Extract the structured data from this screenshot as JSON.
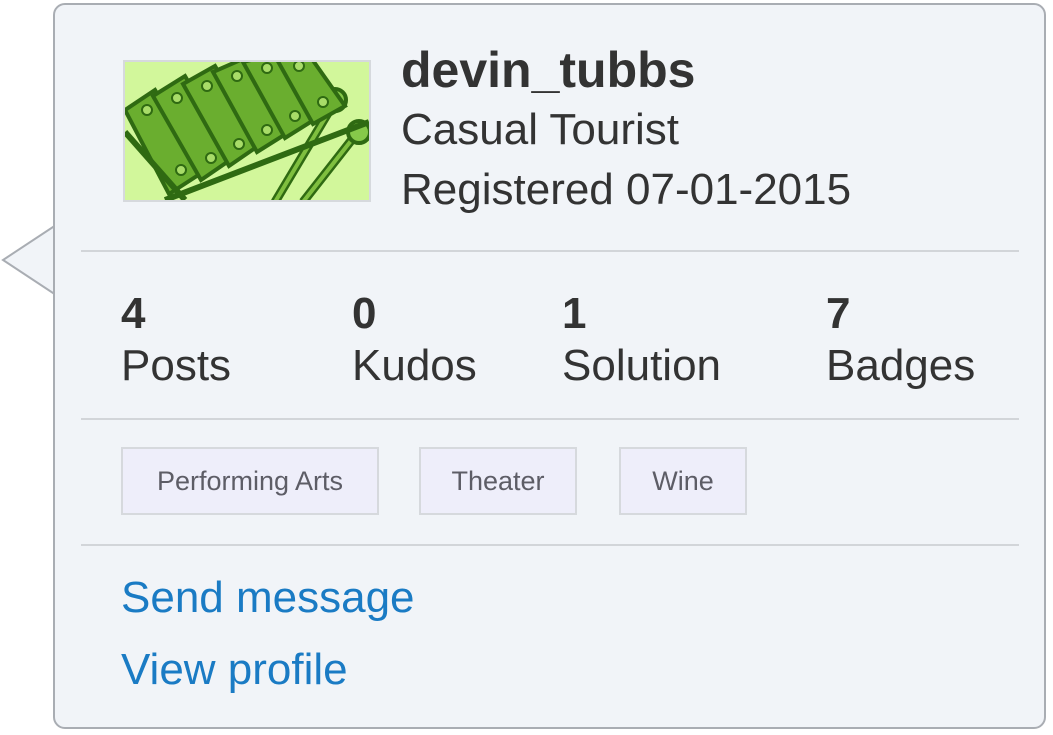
{
  "user": {
    "username": "devin_tubbs",
    "rank": "Casual Tourist",
    "registered": "Registered 07-01-2015",
    "avatar_icon": "xylophone-icon"
  },
  "stats": [
    {
      "value": "4",
      "label": "Posts"
    },
    {
      "value": "0",
      "label": "Kudos"
    },
    {
      "value": "1",
      "label": "Solution"
    },
    {
      "value": "7",
      "label": "Badges"
    }
  ],
  "interests": [
    "Performing Arts",
    "Theater",
    "Wine"
  ],
  "actions": {
    "send_message": "Send message",
    "view_profile": "View profile"
  },
  "colors": {
    "card_background": "#f1f4f8",
    "link": "#1a7bc4",
    "avatar_background": "#d2f79b",
    "tag_background": "#eeeefa"
  }
}
